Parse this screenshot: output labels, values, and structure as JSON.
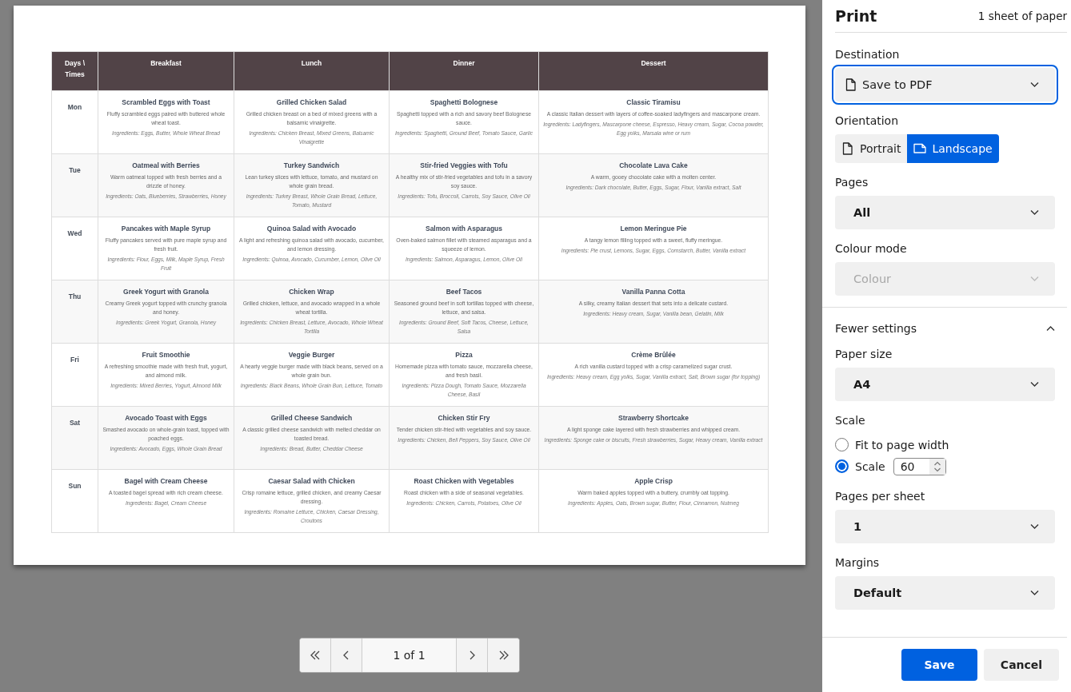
{
  "preview": {
    "table": {
      "columns": [
        "Days \\ Times",
        "Breakfast",
        "Lunch",
        "Dinner",
        "Dessert"
      ],
      "rows": [
        {
          "day": "Mon",
          "meals": [
            {
              "name": "Scrambled Eggs with Toast",
              "description": "Fluffy scrambled eggs paired with buttered whole wheat toast.",
              "ingredients": "Ingredients: Eggs, Butter, Whole Wheat Bread"
            },
            {
              "name": "Grilled Chicken Salad",
              "description": "Grilled chicken breast on a bed of mixed greens with a balsamic vinaigrette.",
              "ingredients": "Ingredients: Chicken Breast, Mixed Greens, Balsamic Vinaigrette"
            },
            {
              "name": "Spaghetti Bolognese",
              "description": "Spaghetti topped with a rich and savory beef Bolognese sauce.",
              "ingredients": "Ingredients: Spaghetti, Ground Beef, Tomato Sauce, Garlic"
            },
            {
              "name": "Classic Tiramisu",
              "description": "A classic Italian dessert with layers of coffee-soaked ladyfingers and mascarpone cream.",
              "ingredients": "Ingredients: Ladyfingers, Mascarpone cheese, Espresso, Heavy cream, Sugar, Cocoa powder, Egg yolks, Marsala wine or rum"
            }
          ]
        },
        {
          "day": "Tue",
          "meals": [
            {
              "name": "Oatmeal with Berries",
              "description": "Warm oatmeal topped with fresh berries and a drizzle of honey.",
              "ingredients": "Ingredients: Oats, Blueberries, Strawberries, Honey"
            },
            {
              "name": "Turkey Sandwich",
              "description": "Lean turkey slices with lettuce, tomato, and mustard on whole grain bread.",
              "ingredients": "Ingredients: Turkey Breast, Whole Grain Bread, Lettuce, Tomato, Mustard"
            },
            {
              "name": "Stir-fried Veggies with Tofu",
              "description": "A healthy mix of stir-fried vegetables and tofu in a savory soy sauce.",
              "ingredients": "Ingredients: Tofu, Broccoli, Carrots, Soy Sauce, Olive Oil"
            },
            {
              "name": "Chocolate Lava Cake",
              "description": "A warm, gooey chocolate cake with a molten center.",
              "ingredients": "Ingredients: Dark chocolate, Butter, Eggs, Sugar, Flour, Vanilla extract, Salt"
            }
          ]
        },
        {
          "day": "Wed",
          "meals": [
            {
              "name": "Pancakes with Maple Syrup",
              "description": "Fluffy pancakes served with pure maple syrup and fresh fruit.",
              "ingredients": "Ingredients: Flour, Eggs, Milk, Maple Syrup, Fresh Fruit"
            },
            {
              "name": "Quinoa Salad with Avocado",
              "description": "A light and refreshing quinoa salad with avocado, cucumber, and lemon dressing.",
              "ingredients": "Ingredients: Quinoa, Avocado, Cucumber, Lemon, Olive Oil"
            },
            {
              "name": "Salmon with Asparagus",
              "description": "Oven-baked salmon fillet with steamed asparagus and a squeeze of lemon.",
              "ingredients": "Ingredients: Salmon, Asparagus, Lemon, Olive Oil"
            },
            {
              "name": "Lemon Meringue Pie",
              "description": "A tangy lemon filling topped with a sweet, fluffy meringue.",
              "ingredients": "Ingredients: Pie crust, Lemons, Sugar, Eggs, Cornstarch, Butter, Vanilla extract"
            }
          ]
        },
        {
          "day": "Thu",
          "meals": [
            {
              "name": "Greek Yogurt with Granola",
              "description": "Creamy Greek yogurt topped with crunchy granola and honey.",
              "ingredients": "Ingredients: Greek Yogurt, Granola, Honey"
            },
            {
              "name": "Chicken Wrap",
              "description": "Grilled chicken, lettuce, and avocado wrapped in a whole wheat tortilla.",
              "ingredients": "Ingredients: Chicken Breast, Lettuce, Avocado, Whole Wheat Tortilla"
            },
            {
              "name": "Beef Tacos",
              "description": "Seasoned ground beef in soft tortillas topped with cheese, lettuce, and salsa.",
              "ingredients": "Ingredients: Ground Beef, Soft Tacos, Cheese, Lettuce, Salsa"
            },
            {
              "name": "Vanilla Panna Cotta",
              "description": "A silky, creamy Italian dessert that sets into a delicate custard.",
              "ingredients": "Ingredients: Heavy cream, Sugar, Vanilla bean, Gelatin, Milk"
            }
          ]
        },
        {
          "day": "Fri",
          "meals": [
            {
              "name": "Fruit Smoothie",
              "description": "A refreshing smoothie made with fresh fruit, yogurt, and almond milk.",
              "ingredients": "Ingredients: Mixed Berries, Yogurt, Almond Milk"
            },
            {
              "name": "Veggie Burger",
              "description": "A hearty veggie burger made with black beans, served on a whole grain bun.",
              "ingredients": "Ingredients: Black Beans, Whole Grain Bun, Lettuce, Tomato"
            },
            {
              "name": "Pizza",
              "description": "Homemade pizza with tomato sauce, mozzarella cheese, and fresh basil.",
              "ingredients": "Ingredients: Pizza Dough, Tomato Sauce, Mozzarella Cheese, Basil"
            },
            {
              "name": "Crème Brûlée",
              "description": "A rich vanilla custard topped with a crisp caramelized sugar crust.",
              "ingredients": "Ingredients: Heavy cream, Egg yolks, Sugar, Vanilla extract, Salt, Brown sugar (for topping)"
            }
          ]
        },
        {
          "day": "Sat",
          "meals": [
            {
              "name": "Avocado Toast with Eggs",
              "description": "Smashed avocado on whole-grain toast, topped with poached eggs.",
              "ingredients": "Ingredients: Avocado, Eggs, Whole Grain Bread"
            },
            {
              "name": "Grilled Cheese Sandwich",
              "description": "A classic grilled cheese sandwich with melted cheddar on toasted bread.",
              "ingredients": "Ingredients: Bread, Butter, Cheddar Cheese"
            },
            {
              "name": "Chicken Stir Fry",
              "description": "Tender chicken stir-fried with vegetables and soy sauce.",
              "ingredients": "Ingredients: Chicken, Bell Peppers, Soy Sauce, Olive Oil"
            },
            {
              "name": "Strawberry Shortcake",
              "description": "A light sponge cake layered with fresh strawberries and whipped cream.",
              "ingredients": "Ingredients: Sponge cake or biscuits, Fresh strawberries, Sugar, Heavy cream, Vanilla extract"
            }
          ]
        },
        {
          "day": "Sun",
          "meals": [
            {
              "name": "Bagel with Cream Cheese",
              "description": "A toasted bagel spread with rich cream cheese.",
              "ingredients": "Ingredients: Bagel, Cream Cheese"
            },
            {
              "name": "Caesar Salad with Chicken",
              "description": "Crisp romaine lettuce, grilled chicken, and creamy Caesar dressing.",
              "ingredients": "Ingredients: Romaine Lettuce, Chicken, Caesar Dressing, Croutons"
            },
            {
              "name": "Roast Chicken with Vegetables",
              "description": "Roast chicken with a side of seasonal vegetables.",
              "ingredients": "Ingredients: Chicken, Carrots, Potatoes, Olive Oil"
            },
            {
              "name": "Apple Crisp",
              "description": "Warm baked apples topped with a buttery, crumbly oat topping.",
              "ingredients": "Ingredients: Apples, Oats, Brown sugar, Butter, Flour, Cinnamon, Nutmeg"
            }
          ]
        }
      ]
    },
    "pager": {
      "page_label": "1 of 1"
    }
  },
  "print_panel": {
    "title": "Print",
    "summary": "1 sheet of paper",
    "fields": [
      {
        "kind": "select",
        "label": "Destination",
        "value": "Save to PDF",
        "focused": true,
        "disabled": false
      },
      {
        "kind": "toggle",
        "label": "Orientation",
        "options": [
          {
            "label": "Portrait",
            "selected": false
          },
          {
            "label": "Landscape",
            "selected": true
          }
        ]
      },
      {
        "kind": "select",
        "label": "Pages",
        "value": "All",
        "focused": false,
        "disabled": false
      },
      {
        "kind": "select",
        "label": "Colour mode",
        "value": "Colour",
        "focused": false,
        "disabled": true
      },
      {
        "kind": "expander",
        "label": "Fewer settings",
        "expanded": true
      },
      {
        "kind": "select",
        "label": "Paper size",
        "value": "A4",
        "focused": false,
        "disabled": false
      },
      {
        "kind": "radio",
        "label": "Scale",
        "options": [
          {
            "label": "Fit to page width",
            "selected": false
          },
          {
            "label": "Scale",
            "selected": true,
            "value": "60"
          }
        ]
      },
      {
        "kind": "select",
        "label": "Pages per sheet",
        "value": "1",
        "focused": false,
        "disabled": false
      },
      {
        "kind": "select",
        "label": "Margins",
        "value": "Default",
        "focused": false,
        "disabled": false
      }
    ],
    "buttons": [
      {
        "label": "Save",
        "primary": true
      },
      {
        "label": "Cancel",
        "primary": false
      }
    ]
  }
}
